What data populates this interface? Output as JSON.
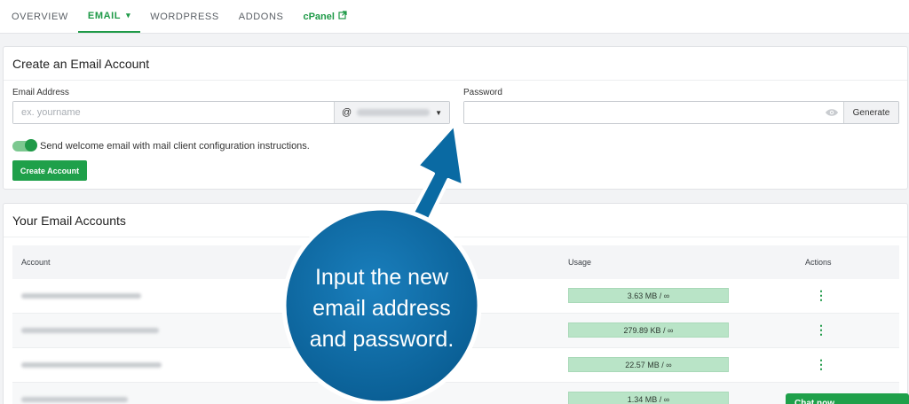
{
  "nav": {
    "tabs": [
      {
        "label": "OVERVIEW"
      },
      {
        "label": "EMAIL",
        "caret": "▾"
      },
      {
        "label": "WORDPRESS"
      },
      {
        "label": "ADDONS"
      },
      {
        "label": "cPanel",
        "ext_icon": "external-link-icon"
      }
    ],
    "active_tab": "EMAIL",
    "accent_color": "#1f9a48"
  },
  "create_card": {
    "title": "Create an Email Account",
    "email_label": "Email Address",
    "email_placeholder": "ex. yourname",
    "email_value": "",
    "domain_prefix": "@",
    "password_label": "Password",
    "password_value": "",
    "generate_label": "Generate",
    "toggle_label": "Send welcome email with mail client configuration instructions.",
    "toggle_on": true,
    "create_button": "Create Account"
  },
  "accounts_card": {
    "title": "Your Email Accounts",
    "columns": {
      "account": "Account",
      "usage": "Usage",
      "actions": "Actions"
    },
    "rows": [
      {
        "usage": "3.63 MB / ∞"
      },
      {
        "usage": "279.89 KB / ∞"
      },
      {
        "usage": "22.57 MB / ∞"
      },
      {
        "usage": "1.34 MB / ∞"
      }
    ]
  },
  "chat": {
    "label": "Chat now"
  },
  "annotation": {
    "text": "Input the new email address and password.",
    "bubble_color": "#0a6aa3"
  }
}
